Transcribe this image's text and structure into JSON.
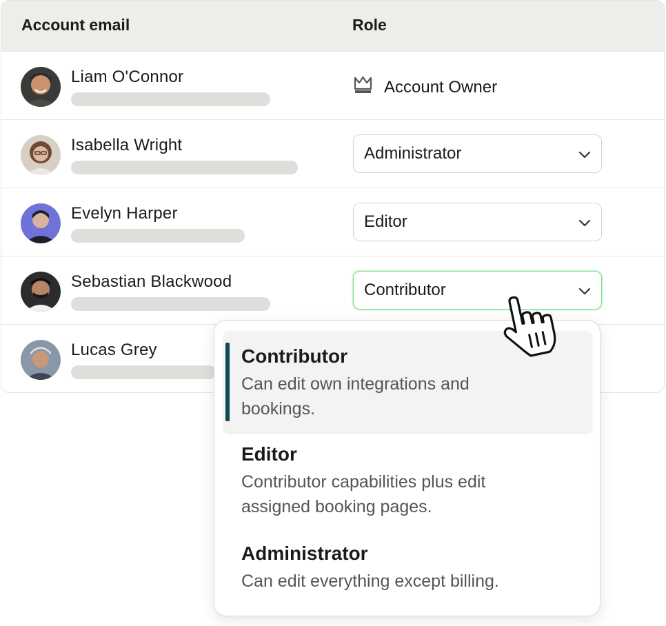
{
  "table": {
    "headers": {
      "email": "Account email",
      "role": "Role"
    },
    "rows": [
      {
        "name": "Liam O'Connor",
        "role": "Account Owner",
        "role_type": "owner",
        "avatar_color": "#8a6a50"
      },
      {
        "name": "Isabella Wright",
        "role": "Administrator",
        "role_type": "select",
        "avatar_color": "#b78f78"
      },
      {
        "name": "Evelyn Harper",
        "role": "Editor",
        "role_type": "select",
        "avatar_color": "#6f73d8"
      },
      {
        "name": "Sebastian Blackwood",
        "role": "Contributor",
        "role_type": "select",
        "active": true,
        "avatar_color": "#4a3a32"
      },
      {
        "name": "Lucas Grey",
        "role": "",
        "role_type": "hidden",
        "avatar_color": "#7d8796"
      }
    ]
  },
  "dropdown": {
    "options": [
      {
        "title": "Contributor",
        "desc": "Can edit own integrations and bookings.",
        "desc_lines": [
          "Can edit own integrations and",
          "bookings."
        ],
        "selected": true
      },
      {
        "title": "Editor",
        "desc": "Contributor capabilities plus edit assigned booking pages.",
        "desc_lines": [
          "Contributor capabilities plus edit",
          "assigned booking pages."
        ],
        "selected": false
      },
      {
        "title": "Administrator",
        "desc": "Can edit everything except billing.",
        "desc_lines": [
          "Can edit everything except billing."
        ],
        "selected": false
      }
    ]
  },
  "icons": {
    "owner": "crown-icon",
    "select": "chevron-down-icon",
    "cursor": "hand-pointer-icon"
  },
  "colors": {
    "header_bg": "#eceeea",
    "active_border": "#7ddf8a",
    "selected_bar": "#0e4a4f",
    "placeholder_bar": "#dddfda"
  }
}
